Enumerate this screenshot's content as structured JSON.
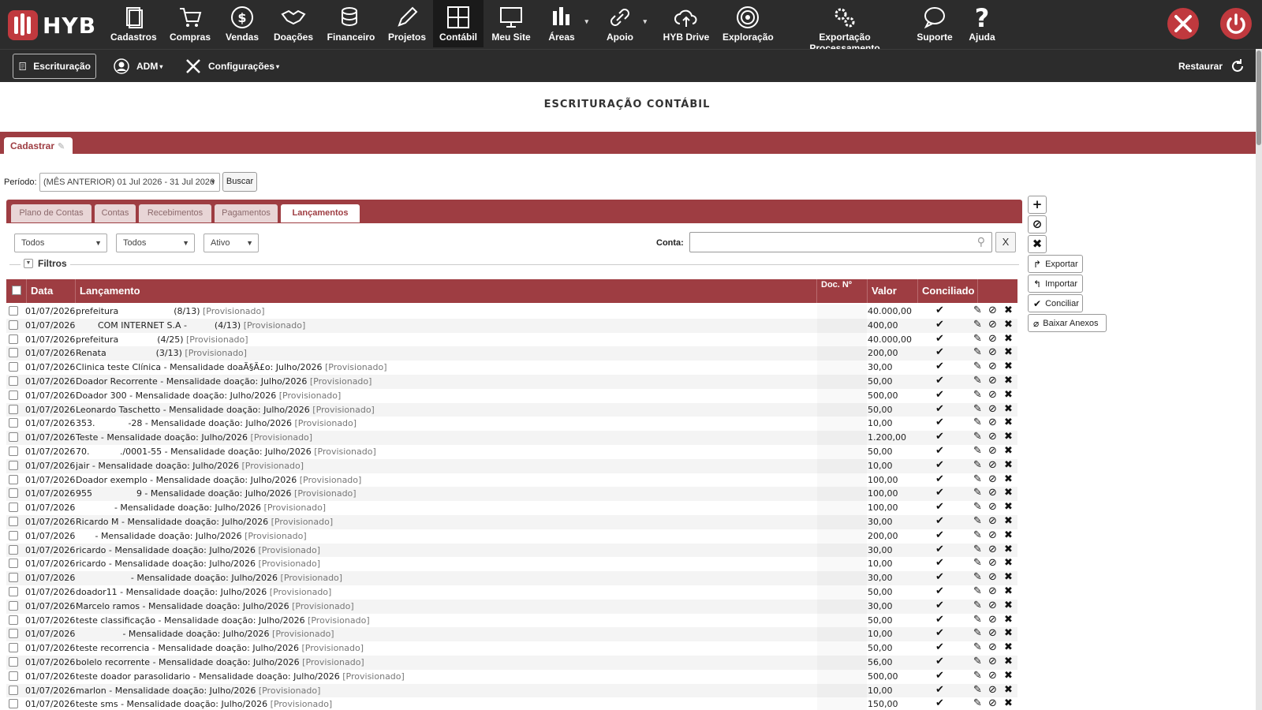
{
  "app": {
    "logo_text": "HYB",
    "brand_color": "#9e3d42"
  },
  "nav": [
    {
      "label": "Cadastros",
      "icon": "document-icon"
    },
    {
      "label": "Compras",
      "icon": "cart-icon"
    },
    {
      "label": "Vendas",
      "icon": "dollar-icon"
    },
    {
      "label": "Doações",
      "icon": "handshake-icon"
    },
    {
      "label": "Financeiro",
      "icon": "coins-icon"
    },
    {
      "label": "Projetos",
      "icon": "pencil-icon"
    },
    {
      "label": "Contábil",
      "icon": "calculator-icon"
    },
    {
      "label": "Meu Site",
      "icon": "monitor-icon"
    },
    {
      "label": "Áreas",
      "icon": "chart-icon"
    },
    {
      "label": "Apoio",
      "icon": "link-icon"
    },
    {
      "label": "HYB Drive",
      "icon": "cloud-upload-icon"
    },
    {
      "label": "Exploração",
      "icon": "target-icon"
    },
    {
      "label": "Exportação Processamento",
      "icon": "gears-icon"
    },
    {
      "label": "Suporte",
      "icon": "chat-icon"
    },
    {
      "label": "Ajuda",
      "icon": "question-icon"
    }
  ],
  "subbar": {
    "escrituracao": "Escrituração",
    "adm": "ADM",
    "configuracoes": "Configurações",
    "restaurar": "Restaurar"
  },
  "page": {
    "title": "ESCRITURAÇÃO CONTÁBIL",
    "tab_cadastrar": "Cadastrar",
    "periodo_label": "Período:",
    "periodo_value": "(MÊS ANTERIOR) 01 Jul 2026 - 31 Jul 2026",
    "buscar": "Buscar"
  },
  "tabs": [
    "Plano de Contas",
    "Contas",
    "Recebimentos",
    "Pagamentos",
    "Lançamentos"
  ],
  "filters": {
    "select1": "Todos",
    "select2": "Todos",
    "select3": "Ativo",
    "conta_label": "Conta:",
    "conta_value": "",
    "clear": "X",
    "filtros": "Filtros"
  },
  "table": {
    "headers": {
      "data": "Data",
      "lancamento": "Lançamento",
      "doc": "Doc. Nº",
      "valor": "Valor",
      "conciliado": "Conciliado"
    },
    "rows": [
      {
        "data": "01/07/2026",
        "lanc": "prefeitura                    (8/13) ",
        "status": "[Provisionado]",
        "valor": "40.000,00"
      },
      {
        "data": "01/07/2026",
        "lanc": "        COM INTERNET S.A -          (4/13) ",
        "status": "[Provisionado]",
        "valor": "400,00"
      },
      {
        "data": "01/07/2026",
        "lanc": "prefeitura              (4/25) ",
        "status": "[Provisionado]",
        "valor": "40.000,00"
      },
      {
        "data": "01/07/2026",
        "lanc": "Renata                  (3/13) ",
        "status": "[Provisionado]",
        "valor": "200,00"
      },
      {
        "data": "01/07/2026",
        "lanc": "Clinica teste Clínica - Mensalidade doaÃ§Ã£o: Julho/2026 ",
        "status": "[Provisionado]",
        "valor": "30,00"
      },
      {
        "data": "01/07/2026",
        "lanc": "Doador Recorrente - Mensalidade doação: Julho/2026 ",
        "status": "[Provisionado]",
        "valor": "50,00"
      },
      {
        "data": "01/07/2026",
        "lanc": "Doador 300 - Mensalidade doação: Julho/2026 ",
        "status": "[Provisionado]",
        "valor": "500,00"
      },
      {
        "data": "01/07/2026",
        "lanc": "Leonardo Taschetto - Mensalidade doação: Julho/2026 ",
        "status": "[Provisionado]",
        "valor": "50,00"
      },
      {
        "data": "01/07/2026",
        "lanc": "353.            -28 - Mensalidade doação: Julho/2026 ",
        "status": "[Provisionado]",
        "valor": "10,00"
      },
      {
        "data": "01/07/2026",
        "lanc": "Teste - Mensalidade doação: Julho/2026 ",
        "status": "[Provisionado]",
        "valor": "1.200,00"
      },
      {
        "data": "01/07/2026",
        "lanc": "70.           ./0001-55 - Mensalidade doação: Julho/2026 ",
        "status": "[Provisionado]",
        "valor": "50,00"
      },
      {
        "data": "01/07/2026",
        "lanc": "jair - Mensalidade doação: Julho/2026 ",
        "status": "[Provisionado]",
        "valor": "10,00"
      },
      {
        "data": "01/07/2026",
        "lanc": "Doador exemplo - Mensalidade doação: Julho/2026 ",
        "status": "[Provisionado]",
        "valor": "100,00"
      },
      {
        "data": "01/07/2026",
        "lanc": "955                9 - Mensalidade doação: Julho/2026 ",
        "status": "[Provisionado]",
        "valor": "100,00"
      },
      {
        "data": "01/07/2026",
        "lanc": "              - Mensalidade doação: Julho/2026 ",
        "status": "[Provisionado]",
        "valor": "100,00"
      },
      {
        "data": "01/07/2026",
        "lanc": "Ricardo M - Mensalidade doação: Julho/2026 ",
        "status": "[Provisionado]",
        "valor": "30,00"
      },
      {
        "data": "01/07/2026",
        "lanc": "       - Mensalidade doação: Julho/2026 ",
        "status": "[Provisionado]",
        "valor": "200,00"
      },
      {
        "data": "01/07/2026",
        "lanc": "ricardo - Mensalidade doação: Julho/2026 ",
        "status": "[Provisionado]",
        "valor": "30,00"
      },
      {
        "data": "01/07/2026",
        "lanc": "ricardo - Mensalidade doação: Julho/2026 ",
        "status": "[Provisionado]",
        "valor": "10,00"
      },
      {
        "data": "01/07/2026",
        "lanc": "                    - Mensalidade doação: Julho/2026 ",
        "status": "[Provisionado]",
        "valor": "30,00"
      },
      {
        "data": "01/07/2026",
        "lanc": "doador11 - Mensalidade doação: Julho/2026 ",
        "status": "[Provisionado]",
        "valor": "50,00"
      },
      {
        "data": "01/07/2026",
        "lanc": "Marcelo ramos - Mensalidade doação: Julho/2026 ",
        "status": "[Provisionado]",
        "valor": "30,00"
      },
      {
        "data": "01/07/2026",
        "lanc": "teste classificação - Mensalidade doação: Julho/2026 ",
        "status": "[Provisionado]",
        "valor": "50,00"
      },
      {
        "data": "01/07/2026",
        "lanc": "                 - Mensalidade doação: Julho/2026 ",
        "status": "[Provisionado]",
        "valor": "10,00"
      },
      {
        "data": "01/07/2026",
        "lanc": "teste recorrencia - Mensalidade doação: Julho/2026 ",
        "status": "[Provisionado]",
        "valor": "50,00"
      },
      {
        "data": "01/07/2026",
        "lanc": "bolelo recorrente - Mensalidade doação: Julho/2026 ",
        "status": "[Provisionado]",
        "valor": "56,00"
      },
      {
        "data": "01/07/2026",
        "lanc": "teste doador parasolidario - Mensalidade doação: Julho/2026 ",
        "status": "[Provisionado]",
        "valor": "500,00"
      },
      {
        "data": "01/07/2026",
        "lanc": "marlon - Mensalidade doação: Julho/2026 ",
        "status": "[Provisionado]",
        "valor": "10,00"
      },
      {
        "data": "01/07/2026",
        "lanc": "teste sms - Mensalidade doação: Julho/2026 ",
        "status": "[Provisionado]",
        "valor": "150,00"
      }
    ]
  },
  "side_actions": {
    "add": "+",
    "block": "⊘",
    "remove": "✖",
    "exportar": "Exportar",
    "importar": "Importar",
    "conciliar": "Conciliar",
    "baixar_anexos": "Baixar Anexos"
  },
  "row_icons": {
    "conciliado": "✔",
    "edit": "✎",
    "block": "⊘",
    "delete": "✖"
  }
}
